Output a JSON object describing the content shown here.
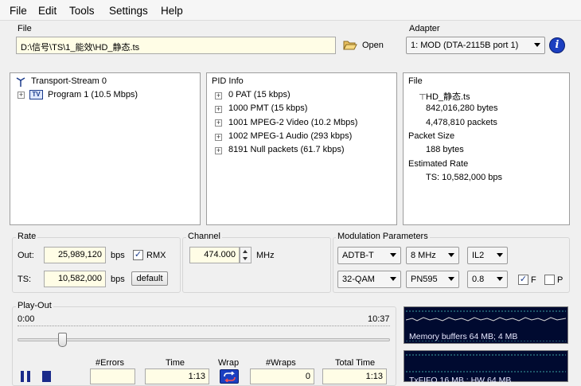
{
  "menu": [
    "File",
    "Edit",
    "Tools",
    "Settings",
    "Help"
  ],
  "file": {
    "label": "File",
    "path": "D:\\信号\\TS\\1_能效\\HD_静态.ts",
    "open_label": "Open"
  },
  "adapter": {
    "label": "Adapter",
    "selected": "1: MOD  (DTA-2115B port 1)"
  },
  "stream_tree": {
    "root": "Transport-Stream  0",
    "program": "Program 1 (10.5 Mbps)",
    "program_badge": "TV"
  },
  "pid_info": {
    "title": "PID Info",
    "items": [
      "0 PAT  (15 kbps)",
      "1000 PMT  (15 kbps)",
      "1001 MPEG-2 Video  (10.2 Mbps)",
      "1002 MPEG-1 Audio  (293 kbps)",
      "8191 Null packets  (61.7 kbps)"
    ]
  },
  "file_info": {
    "file_title": "File",
    "file_items": [
      "HD_静态.ts",
      "842,016,280 bytes",
      "4,478,810 packets"
    ],
    "packet_size_title": "Packet Size",
    "packet_size": "188 bytes",
    "est_rate_title": "Estimated Rate",
    "est_rate": "TS: 10,582,000 bps"
  },
  "rate": {
    "title": "Rate",
    "out_label": "Out:",
    "out_value": "25,989,120",
    "out_unit": "bps",
    "rmx_label": "RMX",
    "ts_label": "TS:",
    "ts_value": "10,582,000",
    "ts_unit": "bps",
    "default_label": "default"
  },
  "channel": {
    "title": "Channel",
    "value": "474.000",
    "unit": "MHz"
  },
  "modulation": {
    "title": "Modulation Parameters",
    "standard": "ADTB-T",
    "bandwidth": "8 MHz",
    "il": "IL2",
    "constellation": "32-QAM",
    "pn": "PN595",
    "code_rate": "0.8",
    "f_label": "F",
    "p_label": "P"
  },
  "playout": {
    "title": "Play-Out",
    "start_time": "0:00",
    "end_time": "10:37",
    "position_fraction": 0.12,
    "headers": [
      "#Errors",
      "Time",
      "Wrap",
      "#Wraps",
      "Total Time"
    ],
    "errors": "",
    "time": "1:13",
    "wraps": "0",
    "total_time": "1:13"
  },
  "scopes": {
    "memory": "Memory buffers 64 MB; 4 MB",
    "fifo": "TxFIFO 16 MB ; HW 64 MB"
  }
}
